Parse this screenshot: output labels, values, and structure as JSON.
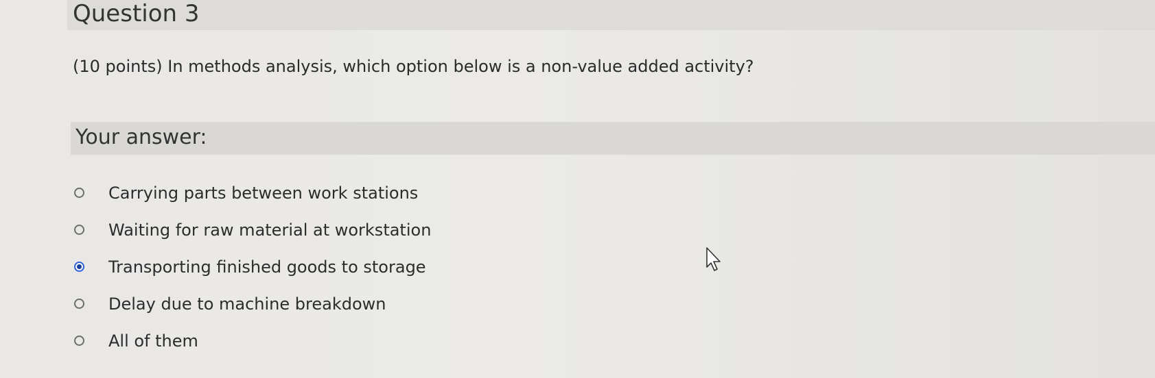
{
  "question": {
    "title": "Question 3",
    "prompt": "(10 points) In methods analysis, which option below is a non-value added activity?"
  },
  "answer": {
    "heading": "Your answer:",
    "options": [
      {
        "label": "Carrying parts between work stations",
        "selected": false
      },
      {
        "label": "Waiting for raw material at workstation",
        "selected": false
      },
      {
        "label": "Transporting finished goods to storage",
        "selected": true
      },
      {
        "label": "Delay due to machine breakdown",
        "selected": false
      },
      {
        "label": "All of them",
        "selected": false
      }
    ]
  },
  "colors": {
    "background": "#e9e8e5",
    "header_band": "#dddcd8",
    "selected_radio": "#173f9e",
    "text": "#2a2a2a"
  },
  "icons": {
    "cursor": "mouse-pointer-icon",
    "radio_unchecked": "radio-unchecked-icon",
    "radio_checked": "radio-checked-icon"
  }
}
